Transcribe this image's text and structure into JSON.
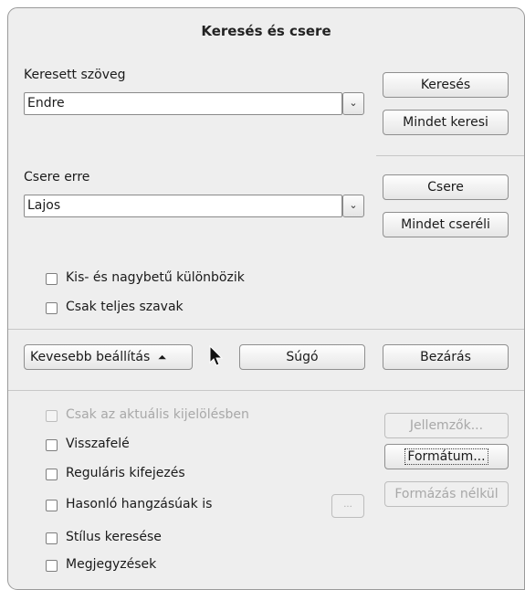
{
  "dialog": {
    "title": "Keresés és csere"
  },
  "search": {
    "label": "Keresett szöveg",
    "value": "Endre",
    "find_button": "Keresés",
    "find_all_button": "Mindet keresi"
  },
  "replace": {
    "label": "Csere erre",
    "value": "Lajos",
    "replace_button": "Csere",
    "replace_all_button": "Mindet cseréli"
  },
  "options": {
    "match_case": "Kis- és nagybetű különbözik",
    "whole_words": "Csak teljes szavak"
  },
  "actions": {
    "fewer_options": "Kevesebb beállítás",
    "help": "Súgó",
    "close": "Bezárás"
  },
  "more_options": {
    "current_selection": "Csak az aktuális kijelölésben",
    "backwards": "Visszafelé",
    "regex": "Reguláris kifejezés",
    "similarity": "Hasonló hangzásúak is",
    "styles": "Stílus keresése",
    "comments": "Megjegyzések",
    "attributes_button": "Jellemzők...",
    "format_button": "Formátum...",
    "no_format_button": "Formázás nélkül",
    "similarity_options_button": "..."
  },
  "icons": {
    "combo_arrow": "⌄",
    "collapse_arrow": "⏶"
  }
}
